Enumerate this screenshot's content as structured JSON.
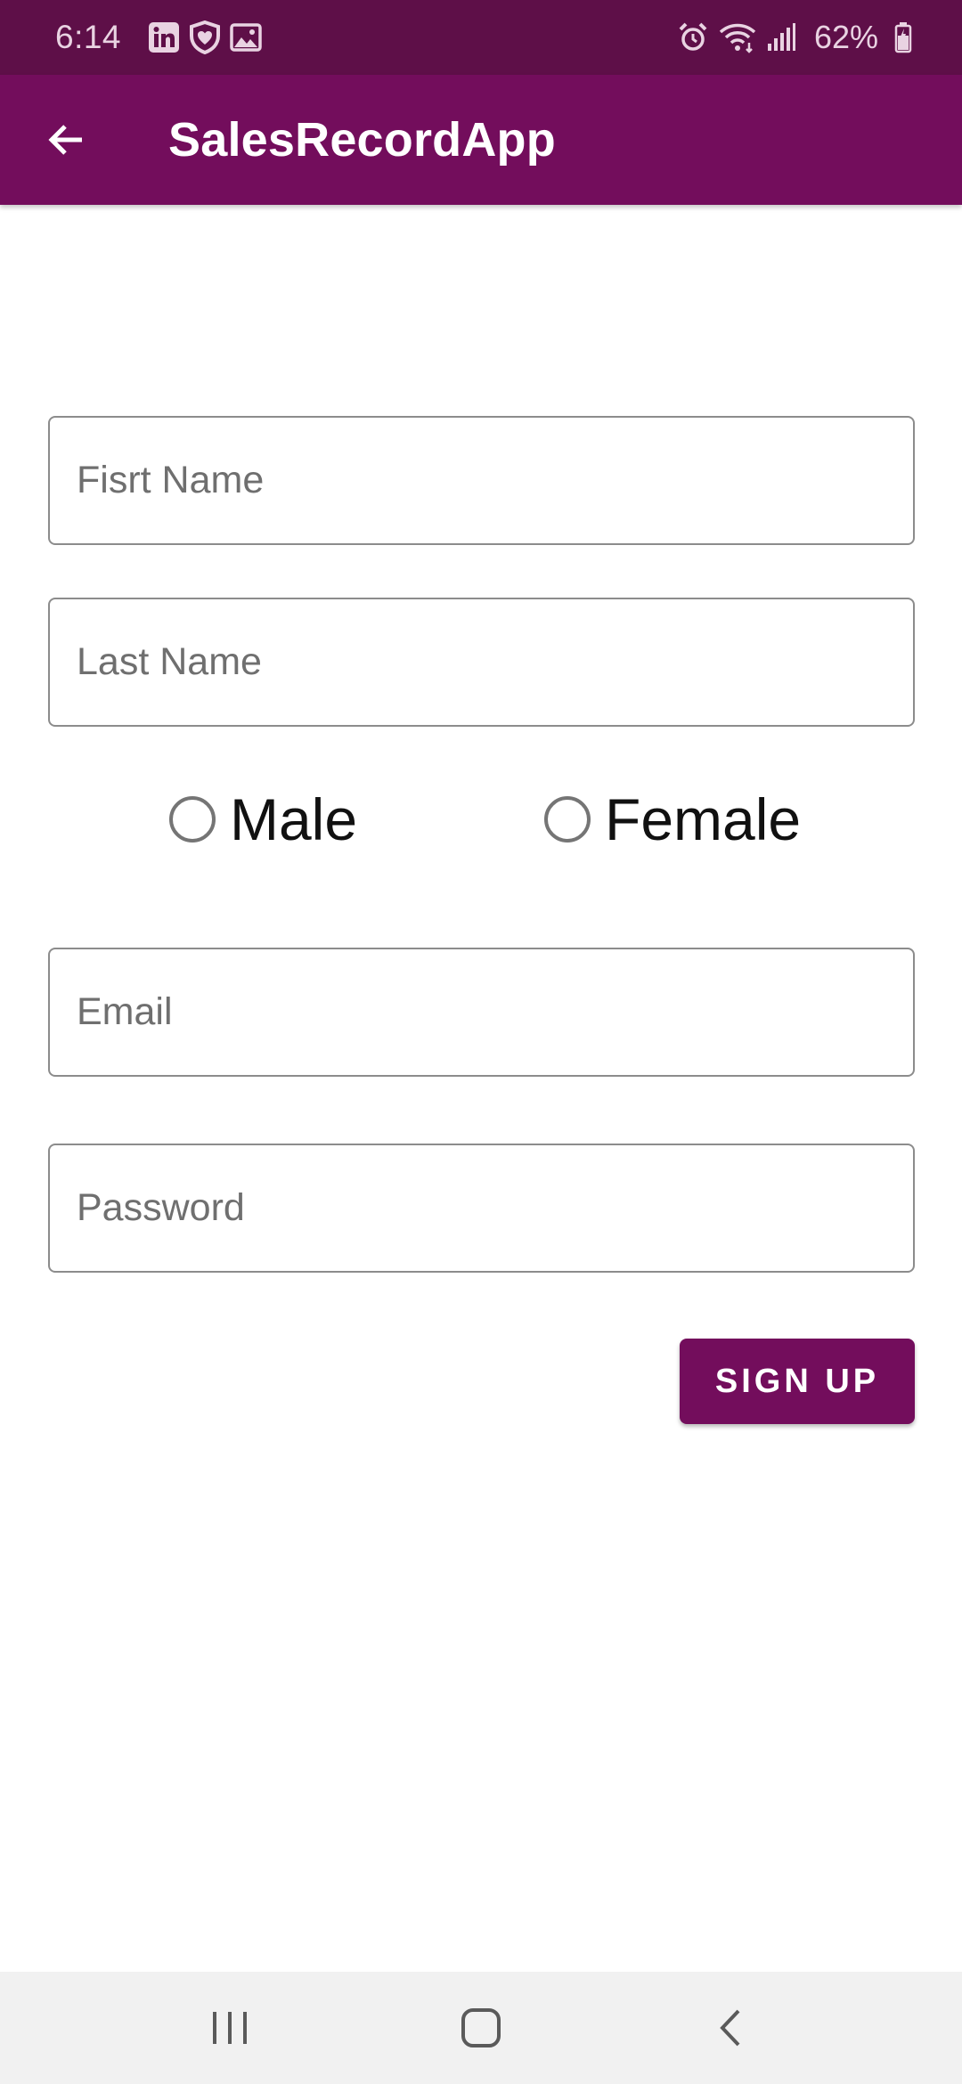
{
  "status_bar": {
    "time": "6:14",
    "battery": "62%",
    "left_icons": [
      "linkedin-icon",
      "shield-heart-icon",
      "image-icon"
    ],
    "right_icons": [
      "alarm-icon",
      "wifi-icon",
      "signal-icon",
      "battery-icon"
    ]
  },
  "app_bar": {
    "title": "SalesRecordApp",
    "back_icon": "arrow-back-icon",
    "background": "#730d5c"
  },
  "form": {
    "first_name": {
      "placeholder": "Fisrt Name",
      "value": ""
    },
    "last_name": {
      "placeholder": "Last Name",
      "value": ""
    },
    "gender": {
      "options": [
        {
          "label": "Male",
          "selected": false
        },
        {
          "label": "Female",
          "selected": false
        }
      ]
    },
    "email": {
      "placeholder": "Email",
      "value": ""
    },
    "password": {
      "placeholder": "Password",
      "value": ""
    },
    "signup_label": "SIGN UP"
  },
  "nav_bar": {
    "buttons": [
      "recent-apps-icon",
      "home-icon",
      "back-nav-icon"
    ]
  },
  "colors": {
    "status_bar": "#5e0f48",
    "primary": "#730d5c",
    "nav_bar": "#f1f1f1"
  }
}
